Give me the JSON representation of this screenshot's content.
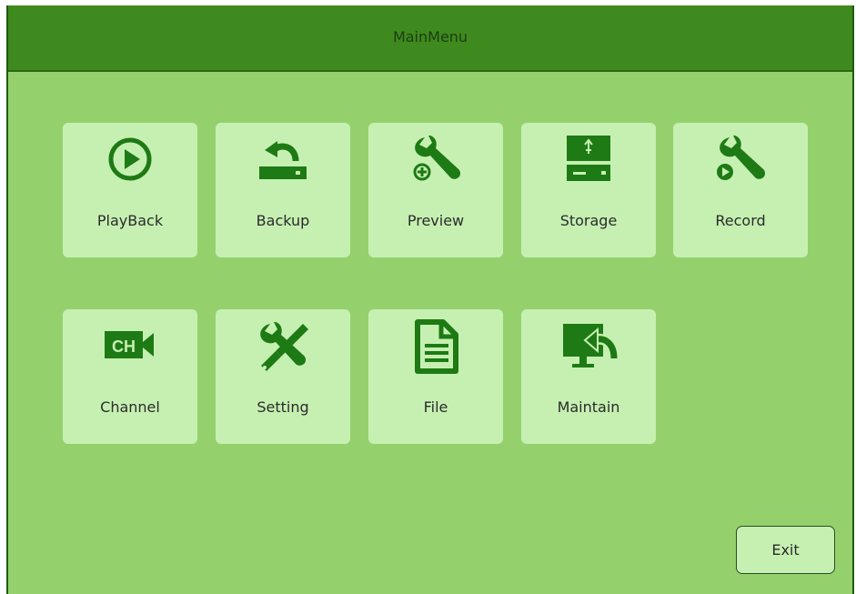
{
  "window": {
    "title": "MainMenu"
  },
  "menu": {
    "items": [
      {
        "label": "PlayBack",
        "icon": "play-circle-icon"
      },
      {
        "label": "Backup",
        "icon": "backup-icon"
      },
      {
        "label": "Preview",
        "icon": "wrench-preview-icon"
      },
      {
        "label": "Storage",
        "icon": "storage-drive-icon"
      },
      {
        "label": "Record",
        "icon": "wrench-record-icon"
      },
      {
        "label": "Channel",
        "icon": "channel-camera-icon"
      },
      {
        "label": "Setting",
        "icon": "tools-icon"
      },
      {
        "label": "File",
        "icon": "document-icon"
      },
      {
        "label": "Maintain",
        "icon": "monitor-arrow-icon"
      }
    ]
  },
  "footer": {
    "exit_label": "Exit"
  },
  "colors": {
    "background": "#94d16c",
    "titlebar": "#3e8a1e",
    "tile": "#c6f0b2",
    "icon": "#1e7a14"
  }
}
